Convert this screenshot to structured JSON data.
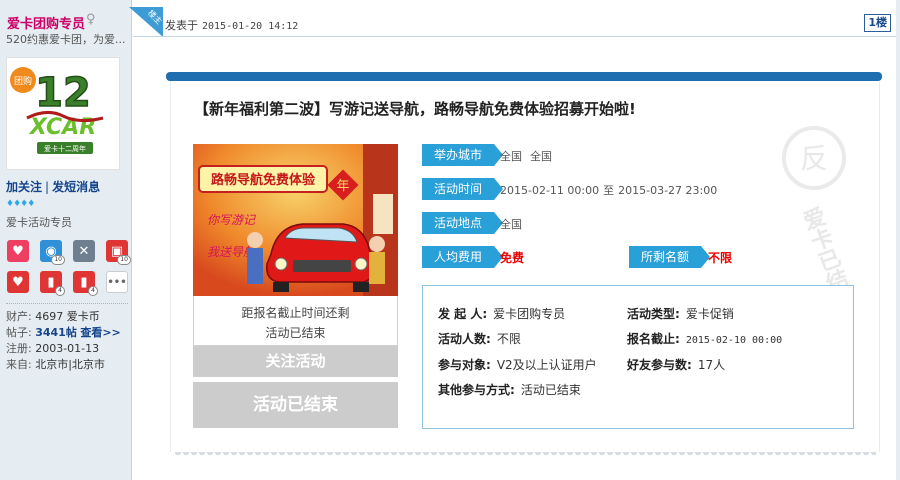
{
  "user": {
    "name": "爱卡团购专员",
    "gender_icon": "female-symbol-icon",
    "signature": "520约惠爱卡团，为爱...",
    "avatar_logo_text": "12",
    "avatar_brand_text": "XCAR",
    "avatar_banner_text": "爱卡十二周年",
    "avatar_seal_text": "团购",
    "actions": {
      "follow": "加关注",
      "separator": "|",
      "message": "发短消息"
    },
    "gems": "♦♦♦♦",
    "rank": "爱卡活动专员",
    "stats": {
      "wealth_label": "财产:",
      "wealth_value": "4697 爱卡币",
      "posts_label": "帖子:",
      "posts_value": "3441帖",
      "posts_link": "查看>>",
      "reg_label": "注册:",
      "reg_value": "2003-01-13",
      "from_label": "来自:",
      "from_value": "北京市|北京市"
    }
  },
  "post": {
    "corner_label": "楼主",
    "posted_label": "发表于",
    "posted_time": "2015-01-20 14:12",
    "floor": "1楼"
  },
  "activity": {
    "title": "【新年福利第二波】写游记送导航，路畅导航免费体验招募开始啦!",
    "poster_headline": "路畅导航免费体验",
    "poster_line1": "你写游记",
    "poster_line2": "我送导航",
    "poster_year_char": "年",
    "deadline_line1": "距报名截止时间还剩",
    "deadline_line2": "活动已结束",
    "follow_button": "关注活动",
    "ended_button": "活动已结束",
    "fields": {
      "city_label": "举办城市",
      "city_value1": "全国",
      "city_value2": "全国",
      "time_label": "活动时间",
      "time_start": "2015-02-11 00:00",
      "time_to": "至",
      "time_end": "2015-03-27 23:00",
      "place_label": "活动地点",
      "place_value": "全国",
      "fee_label": "人均费用",
      "fee_value": "免费",
      "quota_label": "所剩名额",
      "quota_value": "不限"
    },
    "info": {
      "organizer_label": "发 起 人:",
      "organizer_value": "爱卡团购专员",
      "type_label": "活动类型:",
      "type_value": "爱卡促销",
      "people_label": "活动人数:",
      "people_value": "不限",
      "deadline_label": "报名截止:",
      "deadline_value": "2015-02-10 00:00",
      "target_label": "参与对象:",
      "target_value": "V2及以上认证用户",
      "friends_label": "好友参与数:",
      "friends_value": "17人",
      "other_label": "其他参与方式:",
      "other_value": "活动已结束"
    },
    "stamp_text": "爱卡已结束",
    "stamp_char": "反"
  },
  "colors": {
    "accent": "#2aa0d8",
    "header_bar": "#1f6fb0",
    "username": "#cc0066",
    "link": "#16448c",
    "red_value": "#ee0000",
    "disabled_button": "#cccccc"
  }
}
